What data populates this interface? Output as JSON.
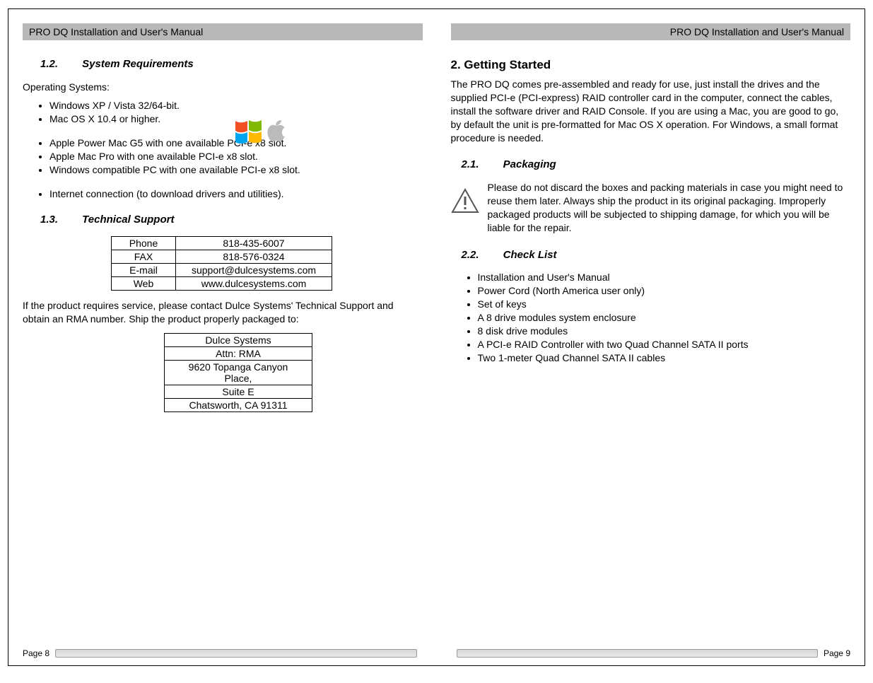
{
  "header_title": "PRO DQ Installation and User's Manual",
  "left": {
    "s12_num": "1.2.",
    "s12_title": "System Requirements",
    "os_label": "Operating Systems:",
    "os_list": [
      "Windows XP / Vista 32/64-bit.",
      "Mac OS X 10.4 or higher."
    ],
    "hw_list": [
      "Apple Power Mac G5 with one available PCI-e x8 slot.",
      "Apple Mac Pro with one available PCI-e x8 slot.",
      "Windows compatible PC with one available PCI-e x8 slot."
    ],
    "net_list": [
      "Internet connection (to download drivers and utilities)."
    ],
    "s13_num": "1.3.",
    "s13_title": "Technical Support",
    "contact": {
      "phone_label": "Phone",
      "phone": "818-435-6007",
      "fax_label": "FAX",
      "fax": "818-576-0324",
      "email_label": "E-mail",
      "email": "support@dulcesystems.com",
      "web_label": "Web",
      "web": "www.dulcesystems.com"
    },
    "rma_text": "If the product requires service, please contact Dulce Systems' Technical Support and obtain an RMA number.  Ship the product properly packaged to:",
    "address": [
      "Dulce Systems",
      "Attn: RMA",
      "9620 Topanga Canyon Place,",
      "Suite E",
      "Chatsworth, CA  91311"
    ],
    "page_label": "Page 8"
  },
  "right": {
    "s2_title": "2. Getting Started",
    "intro": "The PRO DQ comes pre-assembled and ready for use, just install the drives and the supplied PCI-e (PCI-express) RAID controller card in the computer, connect the cables, install the software driver and RAID Console.   If you are using a Mac, you are good to go, by default the unit  is pre-formatted for Mac OS X operation.  For Windows, a small format procedure is needed.",
    "s21_num": "2.1.",
    "s21_title": "Packaging",
    "packaging_text": "Please do not discard the boxes and packing materials in case you might need to reuse them later.  Always ship the product in its original packaging.  Improperly packaged products will be subjected to shipping damage, for which you will be liable for the repair.",
    "s22_num": "2.2.",
    "s22_title": "Check List",
    "checklist": [
      "Installation and User's Manual",
      "Power Cord (North America user only)",
      "Set of keys",
      "A  8 drive modules system enclosure",
      "8 disk drive modules",
      "A PCI-e RAID Controller with two Quad Channel SATA II ports",
      "Two 1-meter Quad Channel SATA II cables"
    ],
    "page_label": "Page 9"
  }
}
